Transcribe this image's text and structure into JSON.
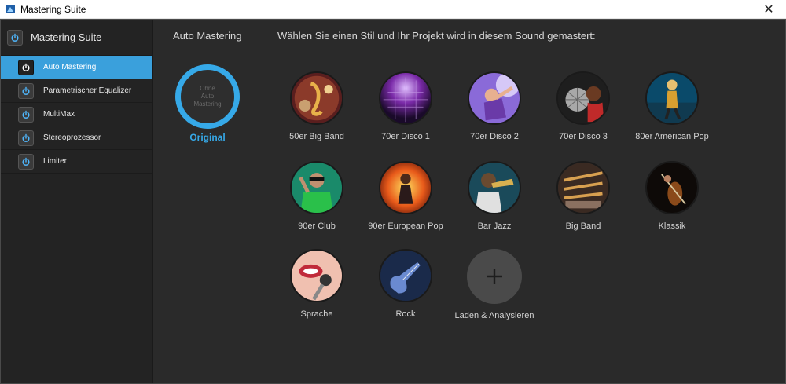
{
  "window": {
    "title": "Mastering Suite"
  },
  "sidebar": {
    "header": "Mastering Suite",
    "items": [
      {
        "label": "Auto Mastering",
        "active": true
      },
      {
        "label": "Parametrischer Equalizer",
        "active": false
      },
      {
        "label": "MultiMax",
        "active": false
      },
      {
        "label": "Stereoprozessor",
        "active": false
      },
      {
        "label": "Limiter",
        "active": false
      }
    ]
  },
  "main": {
    "title": "Auto Mastering",
    "description": "Wählen Sie einen Stil und Ihr Projekt wird in diesem Sound gemastert:",
    "original": {
      "ring_text": "Ohne\nAuto\nMastering",
      "label": "Original"
    },
    "styles": [
      {
        "label": "50er Big Band",
        "icon": "saxophone-photo"
      },
      {
        "label": "70er Disco 1",
        "icon": "disco-ball-photo"
      },
      {
        "label": "70er Disco 2",
        "icon": "disco-dancer-photo"
      },
      {
        "label": "70er Disco 3",
        "icon": "disco-singer-photo"
      },
      {
        "label": "80er American Pop",
        "icon": "stage-performer-photo"
      },
      {
        "label": "90er Club",
        "icon": "club-dj-photo"
      },
      {
        "label": "90er European Pop",
        "icon": "fire-dancer-photo"
      },
      {
        "label": "Bar Jazz",
        "icon": "trumpet-player-photo"
      },
      {
        "label": "Big Band",
        "icon": "brass-section-photo"
      },
      {
        "label": "Klassik",
        "icon": "violin-photo"
      },
      {
        "label": "Sprache",
        "icon": "microphone-mouth-photo"
      },
      {
        "label": "Rock",
        "icon": "electric-guitar-photo"
      }
    ],
    "load_analyze": {
      "label": "Laden & Analysieren",
      "icon": "plus-icon"
    }
  },
  "colors": {
    "accent": "#36a9e8",
    "sidebar_active": "#3aa0dc",
    "background": "#2a2a2a"
  }
}
